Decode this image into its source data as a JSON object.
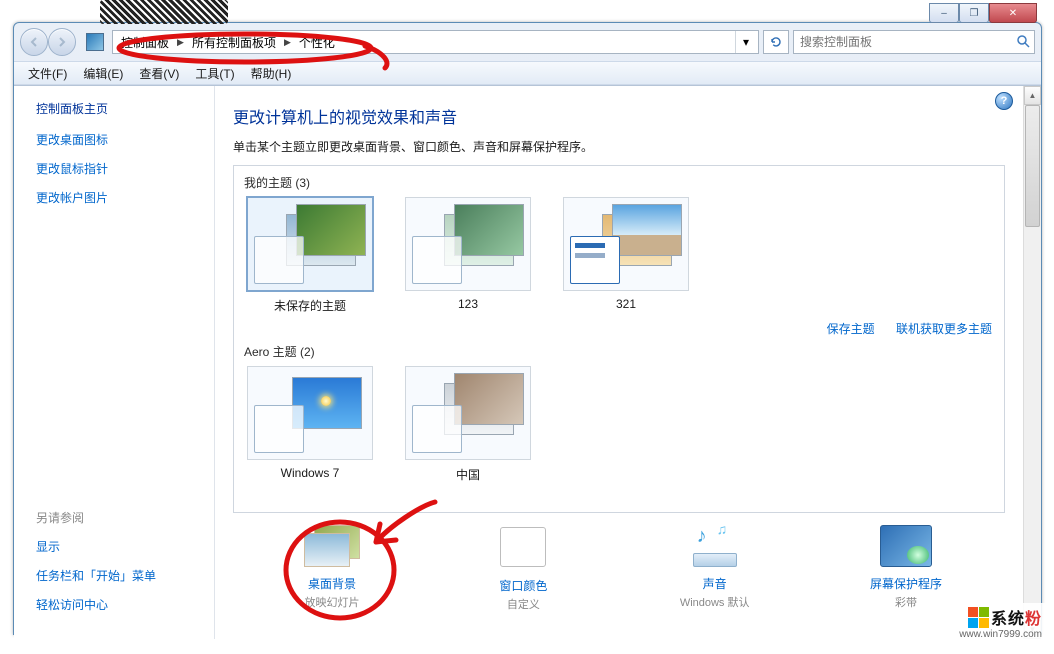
{
  "caption": {
    "min": "–",
    "max": "❐",
    "close": "✕"
  },
  "breadcrumb": {
    "b1": "控制面板",
    "b2": "所有控制面板项",
    "b3": "个性化"
  },
  "search": {
    "placeholder": "搜索控制面板"
  },
  "menu": {
    "file": "文件(F)",
    "edit": "编辑(E)",
    "view": "查看(V)",
    "tools": "工具(T)",
    "help": "帮助(H)"
  },
  "sidebar": {
    "home": "控制面板主页",
    "links": [
      "更改桌面图标",
      "更改鼠标指针",
      "更改帐户图片"
    ],
    "seeAlso": "另请参阅",
    "seeAlsoLinks": [
      "显示",
      "任务栏和「开始」菜单",
      "轻松访问中心"
    ]
  },
  "main": {
    "title": "更改计算机上的视觉效果和声音",
    "subtitle": "单击某个主题立即更改桌面背景、窗口颜色、声音和屏幕保护程序。",
    "myThemesLabel": "我的主题 (3)",
    "myThemes": [
      {
        "name": "未保存的主题"
      },
      {
        "name": "123"
      },
      {
        "name": "321"
      }
    ],
    "saveTheme": "保存主题",
    "getMore": "联机获取更多主题",
    "aeroLabel": "Aero 主题 (2)",
    "aeroThemes": [
      {
        "name": "Windows 7"
      },
      {
        "name": "中国"
      }
    ]
  },
  "actions": {
    "bg": {
      "label": "桌面背景",
      "sub": "放映幻灯片"
    },
    "color": {
      "label": "窗口颜色",
      "sub": "自定义"
    },
    "sound": {
      "label": "声音",
      "sub": "Windows 默认"
    },
    "ss": {
      "label": "屏幕保护程序",
      "sub": "彩带"
    }
  },
  "branding": {
    "line1": "系统",
    "line1b": "粉",
    "line2": "www.win7999.com"
  },
  "help": "?"
}
